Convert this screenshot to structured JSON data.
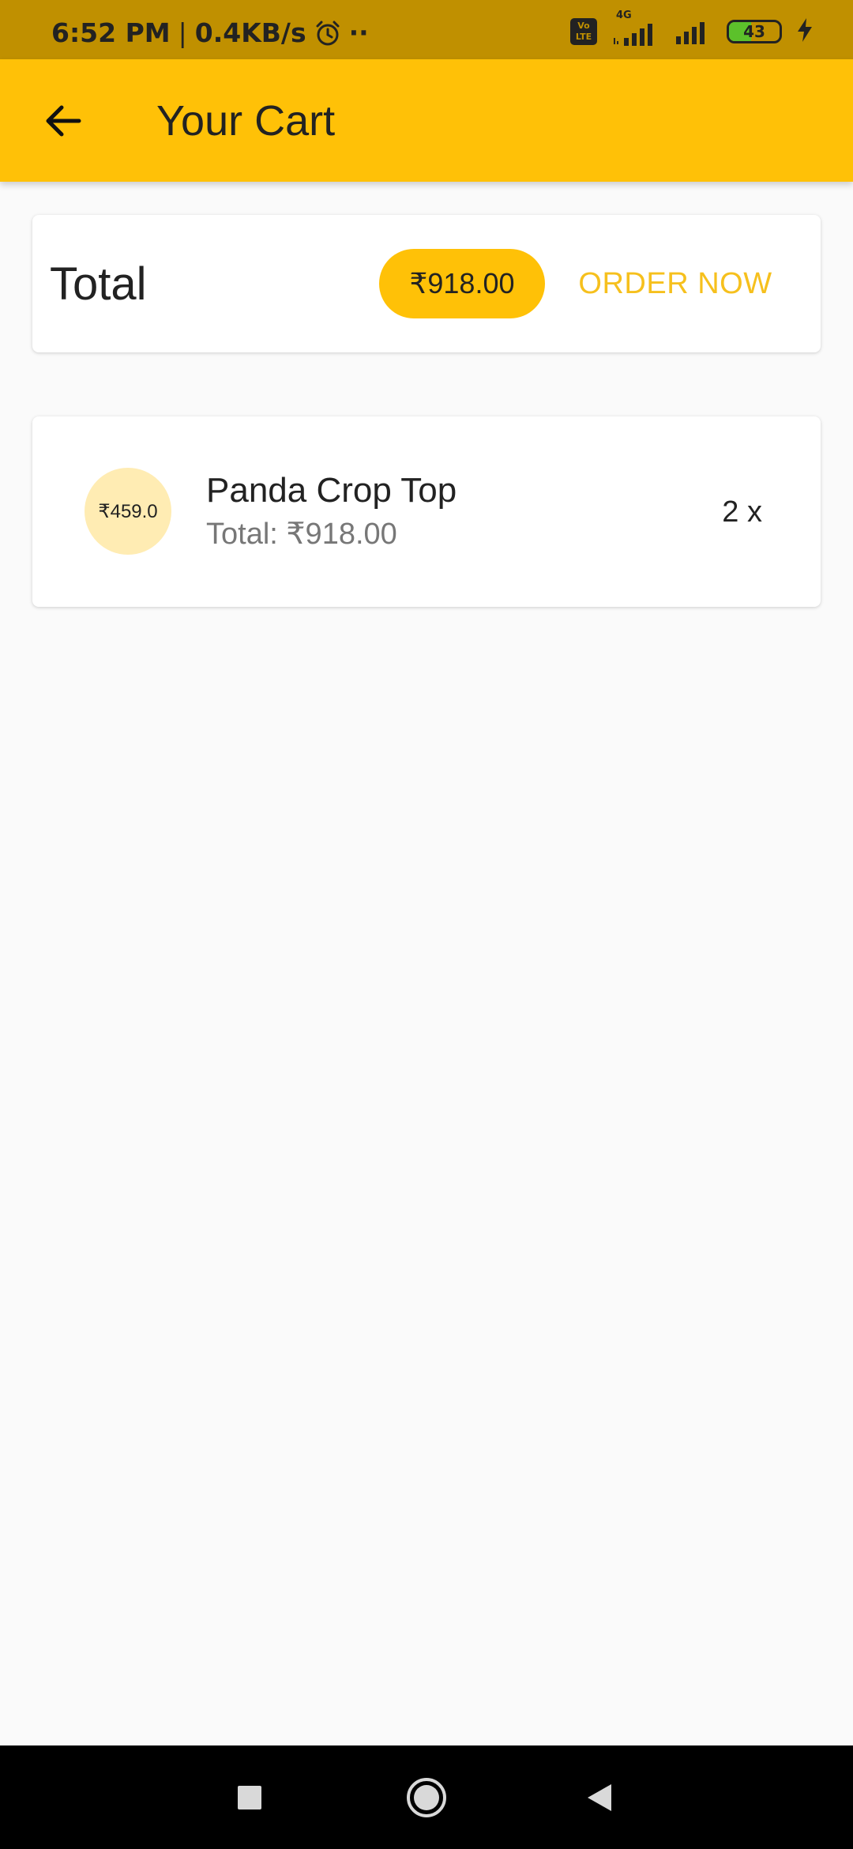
{
  "status_bar": {
    "time": "6:52 PM",
    "separator": "|",
    "speed": "0.4KB/s",
    "dots": "··",
    "volte_top": "Vo",
    "volte_bottom": "LTE",
    "network": "4G",
    "battery_level": "43",
    "battery_fraction": 0.43,
    "icons": [
      "alarm-icon",
      "volte-icon",
      "signal-icon",
      "signal-icon",
      "battery-icon",
      "charging-icon"
    ]
  },
  "app_bar": {
    "back_icon": "arrow-left-icon",
    "title": "Your Cart"
  },
  "total_card": {
    "label": "Total",
    "amount": "₹918.00",
    "order_label": "ORDER NOW"
  },
  "cart_items": [
    {
      "unit_price": "₹459.0",
      "name": "Panda Crop Top",
      "total": "Total: ₹918.00",
      "quantity": "2 x"
    }
  ],
  "nav_bar": {
    "icons": [
      "recents-icon",
      "home-icon",
      "back-icon"
    ]
  },
  "colors": {
    "app_bar": "#ffc107",
    "status_bar": "#c09000",
    "accent_text": "#f6c01d",
    "chip": "#ffc107",
    "avatar": "#ffecb3",
    "background": "#fafafa",
    "battery": "#5cc12b"
  }
}
